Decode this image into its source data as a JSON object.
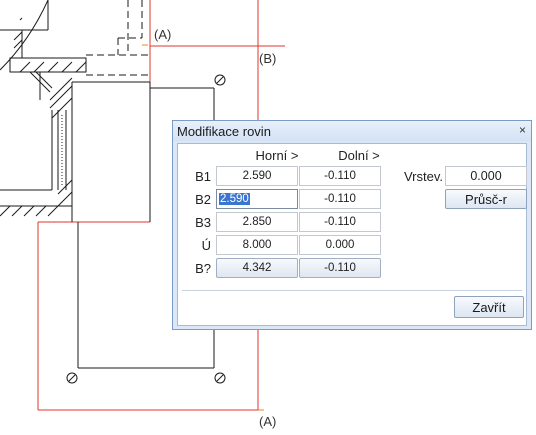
{
  "drawing": {
    "axis_label_a_top": "(A)",
    "axis_label_b": "(B)",
    "axis_label_a_bottom": "(A)"
  },
  "dialog": {
    "title": "Modifikace rovin",
    "close_glyph": "×",
    "col_upper_label": "Horní >",
    "col_lower_label": "Dolní >",
    "rows": [
      {
        "label": "B1",
        "upper": "2.590",
        "lower": "-0.110"
      },
      {
        "label": "B2",
        "upper": "2.590",
        "lower": "-0.110"
      },
      {
        "label": "B3",
        "upper": "2.850",
        "lower": "-0.110"
      },
      {
        "label": "Ú",
        "upper": "8.000",
        "lower": "0.000"
      },
      {
        "label": "B?",
        "upper": "4.342",
        "lower": "-0.110"
      }
    ],
    "vrstev_label": "Vrstev.",
    "vrstev_value": "0.000",
    "prusc_button": "Průsč-r",
    "close_button": "Zavřít"
  },
  "colors": {
    "red_line": "#e0352b",
    "drawing_line": "#1a1a1a",
    "dialog_bg": "#dbe7f7",
    "dialog_border": "#7a9cc6",
    "selection": "#3a76d0"
  }
}
